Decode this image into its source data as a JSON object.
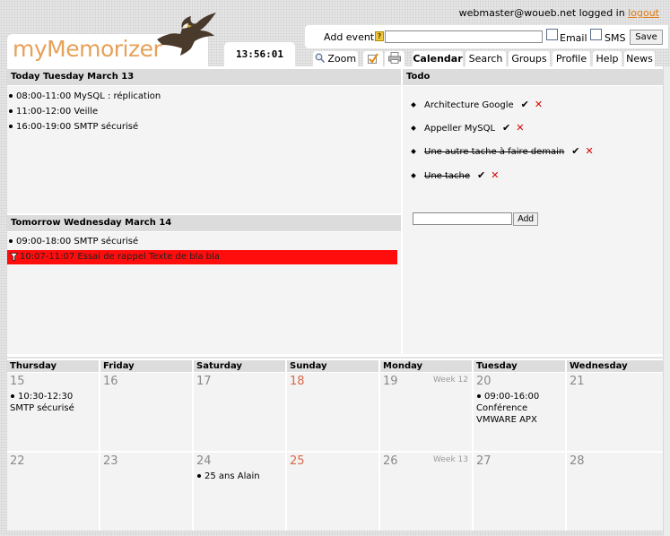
{
  "header": {
    "user_email": "webmaster@woueb.net",
    "logged_in_text": "logged in",
    "logout_label": "logout",
    "logo_text": "myMemorizer",
    "clock": "13:56:01"
  },
  "add_event": {
    "label": "Add event",
    "help_glyph": "?",
    "input_value": "",
    "email_label": "Email",
    "sms_label": "SMS",
    "save_label": "Save"
  },
  "tabs": {
    "zoom": "Zoom",
    "calendar": "Calendar",
    "search": "Search",
    "groups": "Groups",
    "profile": "Profile",
    "help": "Help",
    "news": "News"
  },
  "today": {
    "title": "Today Tuesday March 13",
    "events": [
      "08:00-11:00 MySQL : réplication",
      "11:00-12:00 Veille",
      "16:00-19:00 SMTP sécurisé"
    ]
  },
  "tomorrow": {
    "title": "Tomorrow Wednesday March 14",
    "events": [
      "09:00-18:00 SMTP sécurisé"
    ],
    "reminder": "10:07-11:07 Essai de rappel Texte de bla bla"
  },
  "todo": {
    "title": "Todo",
    "items": [
      {
        "label": "Architecture Google",
        "check": "✔",
        "delete": "✕"
      },
      {
        "label": "Appeller MySQL",
        "check": "✔",
        "delete": "✕"
      },
      {
        "label": "Une autre tache à faire demain",
        "check": "✔",
        "delete": "✕"
      },
      {
        "label": "Une tache",
        "check": "✔",
        "delete": "✕"
      }
    ],
    "add_label": "Add",
    "input_value": ""
  },
  "calendar": {
    "day_names": [
      "Thursday",
      "Friday",
      "Saturday",
      "Sunday",
      "Monday",
      "Tuesday",
      "Wednesday"
    ],
    "weeks": [
      {
        "days": [
          "15",
          "16",
          "17",
          "18",
          "19",
          "20",
          "21"
        ],
        "week_label": "Week 12",
        "events": [
          {
            "day_index": 0,
            "time": "10:30-12:30",
            "text": "SMTP sécurisé"
          },
          {
            "day_index": 5,
            "time": "09:00-16:00",
            "text": "Conférence VMWARE APX"
          }
        ]
      },
      {
        "days": [
          "22",
          "23",
          "24",
          "25",
          "26",
          "27",
          "28"
        ],
        "week_label": "Week 13",
        "events": [
          {
            "day_index": 2,
            "time": "",
            "text": "25 ans Alain"
          }
        ]
      }
    ]
  },
  "colors": {
    "accent_orange": "#e07a14",
    "weekend_red": "#d8684a",
    "reminder_red": "#ff0c0c"
  }
}
